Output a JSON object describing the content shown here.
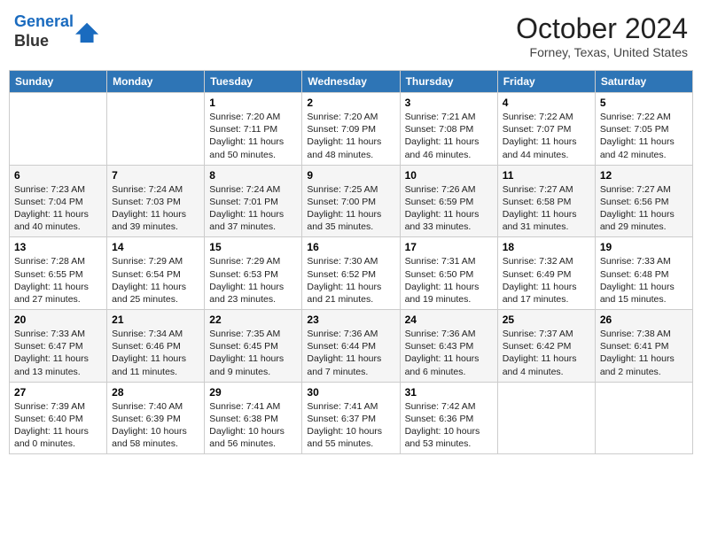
{
  "header": {
    "logo_line1": "General",
    "logo_line2": "Blue",
    "month_title": "October 2024",
    "location": "Forney, Texas, United States"
  },
  "weekdays": [
    "Sunday",
    "Monday",
    "Tuesday",
    "Wednesday",
    "Thursday",
    "Friday",
    "Saturday"
  ],
  "weeks": [
    [
      {
        "day": "",
        "info": ""
      },
      {
        "day": "",
        "info": ""
      },
      {
        "day": "1",
        "info": "Sunrise: 7:20 AM\nSunset: 7:11 PM\nDaylight: 11 hours and 50 minutes."
      },
      {
        "day": "2",
        "info": "Sunrise: 7:20 AM\nSunset: 7:09 PM\nDaylight: 11 hours and 48 minutes."
      },
      {
        "day": "3",
        "info": "Sunrise: 7:21 AM\nSunset: 7:08 PM\nDaylight: 11 hours and 46 minutes."
      },
      {
        "day": "4",
        "info": "Sunrise: 7:22 AM\nSunset: 7:07 PM\nDaylight: 11 hours and 44 minutes."
      },
      {
        "day": "5",
        "info": "Sunrise: 7:22 AM\nSunset: 7:05 PM\nDaylight: 11 hours and 42 minutes."
      }
    ],
    [
      {
        "day": "6",
        "info": "Sunrise: 7:23 AM\nSunset: 7:04 PM\nDaylight: 11 hours and 40 minutes."
      },
      {
        "day": "7",
        "info": "Sunrise: 7:24 AM\nSunset: 7:03 PM\nDaylight: 11 hours and 39 minutes."
      },
      {
        "day": "8",
        "info": "Sunrise: 7:24 AM\nSunset: 7:01 PM\nDaylight: 11 hours and 37 minutes."
      },
      {
        "day": "9",
        "info": "Sunrise: 7:25 AM\nSunset: 7:00 PM\nDaylight: 11 hours and 35 minutes."
      },
      {
        "day": "10",
        "info": "Sunrise: 7:26 AM\nSunset: 6:59 PM\nDaylight: 11 hours and 33 minutes."
      },
      {
        "day": "11",
        "info": "Sunrise: 7:27 AM\nSunset: 6:58 PM\nDaylight: 11 hours and 31 minutes."
      },
      {
        "day": "12",
        "info": "Sunrise: 7:27 AM\nSunset: 6:56 PM\nDaylight: 11 hours and 29 minutes."
      }
    ],
    [
      {
        "day": "13",
        "info": "Sunrise: 7:28 AM\nSunset: 6:55 PM\nDaylight: 11 hours and 27 minutes."
      },
      {
        "day": "14",
        "info": "Sunrise: 7:29 AM\nSunset: 6:54 PM\nDaylight: 11 hours and 25 minutes."
      },
      {
        "day": "15",
        "info": "Sunrise: 7:29 AM\nSunset: 6:53 PM\nDaylight: 11 hours and 23 minutes."
      },
      {
        "day": "16",
        "info": "Sunrise: 7:30 AM\nSunset: 6:52 PM\nDaylight: 11 hours and 21 minutes."
      },
      {
        "day": "17",
        "info": "Sunrise: 7:31 AM\nSunset: 6:50 PM\nDaylight: 11 hours and 19 minutes."
      },
      {
        "day": "18",
        "info": "Sunrise: 7:32 AM\nSunset: 6:49 PM\nDaylight: 11 hours and 17 minutes."
      },
      {
        "day": "19",
        "info": "Sunrise: 7:33 AM\nSunset: 6:48 PM\nDaylight: 11 hours and 15 minutes."
      }
    ],
    [
      {
        "day": "20",
        "info": "Sunrise: 7:33 AM\nSunset: 6:47 PM\nDaylight: 11 hours and 13 minutes."
      },
      {
        "day": "21",
        "info": "Sunrise: 7:34 AM\nSunset: 6:46 PM\nDaylight: 11 hours and 11 minutes."
      },
      {
        "day": "22",
        "info": "Sunrise: 7:35 AM\nSunset: 6:45 PM\nDaylight: 11 hours and 9 minutes."
      },
      {
        "day": "23",
        "info": "Sunrise: 7:36 AM\nSunset: 6:44 PM\nDaylight: 11 hours and 7 minutes."
      },
      {
        "day": "24",
        "info": "Sunrise: 7:36 AM\nSunset: 6:43 PM\nDaylight: 11 hours and 6 minutes."
      },
      {
        "day": "25",
        "info": "Sunrise: 7:37 AM\nSunset: 6:42 PM\nDaylight: 11 hours and 4 minutes."
      },
      {
        "day": "26",
        "info": "Sunrise: 7:38 AM\nSunset: 6:41 PM\nDaylight: 11 hours and 2 minutes."
      }
    ],
    [
      {
        "day": "27",
        "info": "Sunrise: 7:39 AM\nSunset: 6:40 PM\nDaylight: 11 hours and 0 minutes."
      },
      {
        "day": "28",
        "info": "Sunrise: 7:40 AM\nSunset: 6:39 PM\nDaylight: 10 hours and 58 minutes."
      },
      {
        "day": "29",
        "info": "Sunrise: 7:41 AM\nSunset: 6:38 PM\nDaylight: 10 hours and 56 minutes."
      },
      {
        "day": "30",
        "info": "Sunrise: 7:41 AM\nSunset: 6:37 PM\nDaylight: 10 hours and 55 minutes."
      },
      {
        "day": "31",
        "info": "Sunrise: 7:42 AM\nSunset: 6:36 PM\nDaylight: 10 hours and 53 minutes."
      },
      {
        "day": "",
        "info": ""
      },
      {
        "day": "",
        "info": ""
      }
    ]
  ]
}
